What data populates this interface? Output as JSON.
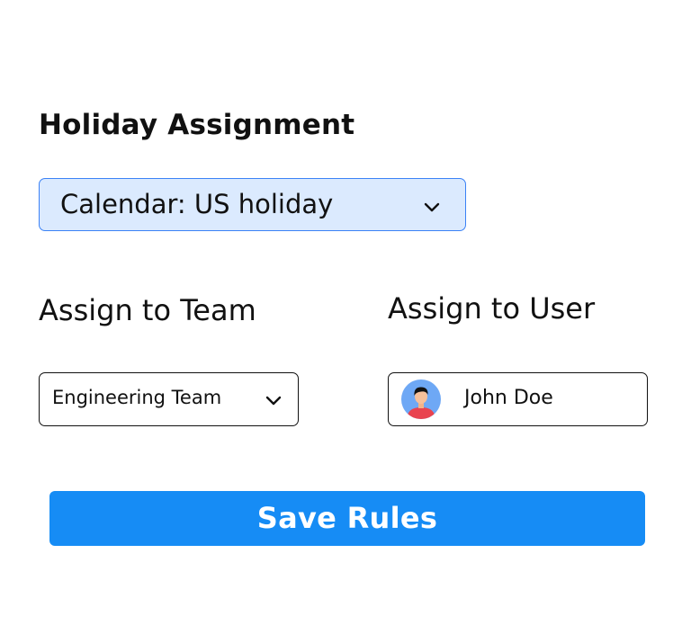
{
  "page": {
    "title": "Holiday Assignment"
  },
  "calendar_select": {
    "value": "Calendar: US holiday",
    "icon": "chevron-down-icon"
  },
  "team": {
    "label": "Assign to Team",
    "selected": "Engineering Team",
    "icon": "chevron-down-icon"
  },
  "user": {
    "label": "Assign to User",
    "selected_name": "John Doe",
    "avatar_icon": "user-avatar-icon"
  },
  "actions": {
    "save_label": "Save Rules"
  },
  "colors": {
    "accent": "#168cf5",
    "select_bg": "#dbeafe",
    "select_border": "#3b82f6",
    "text": "#111111"
  }
}
